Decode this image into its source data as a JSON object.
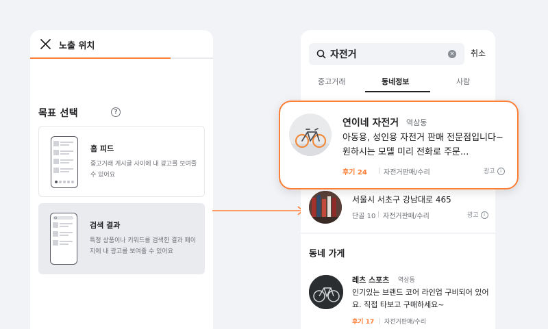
{
  "left_panel": {
    "title": "노출 위치",
    "section_title": "목표 선택",
    "help_glyph": "?",
    "options": [
      {
        "title": "홈 피드",
        "description": "중고거래 게시글 사이에 내 광고를 보여줄 수 있어요"
      },
      {
        "title": "검색 결과",
        "description": "특정 상품이나 키워드를 검색한 결과 페이지에 내 광고를 보여줄 수 있어요"
      }
    ]
  },
  "right_panel": {
    "search_query": "자전거",
    "clear_glyph": "×",
    "cancel_label": "취소",
    "tabs": [
      "중고거래",
      "동네정보",
      "사람"
    ],
    "active_tab": "동네정보",
    "ad_card_behind": {
      "address": "서울시 서초구 강남대로 465",
      "review": "단골 10",
      "category": "자전거판매/수리",
      "ad_label": "광고"
    },
    "neighborhood_section_title": "동네 가게",
    "store": {
      "name": "레츠 스포츠",
      "location": "역삼동",
      "description": "인기있는 브랜드 코어 라인업 구비되어 있어요. 직접 타보고 구매하세요~",
      "review": "후기 17",
      "category": "자전거판매/수리"
    }
  },
  "popup_ad": {
    "name": "연이네 자전거",
    "location": "역삼동",
    "description": "아동용, 성인용 자전거 판매 전문점입니다~ 원하시는 모델 미리 전화로 주문...",
    "review": "후기 24",
    "category": "자전거판매/수리",
    "ad_label": "광고",
    "info_glyph": "i"
  },
  "colors": {
    "accent": "#ff7e36",
    "text": "#212124",
    "sub": "#6b6e75",
    "bg": "#f2f3f6"
  },
  "icons": [
    "close-icon",
    "help-icon",
    "search-icon",
    "clear-icon",
    "info-icon",
    "arrow-right-icon"
  ]
}
